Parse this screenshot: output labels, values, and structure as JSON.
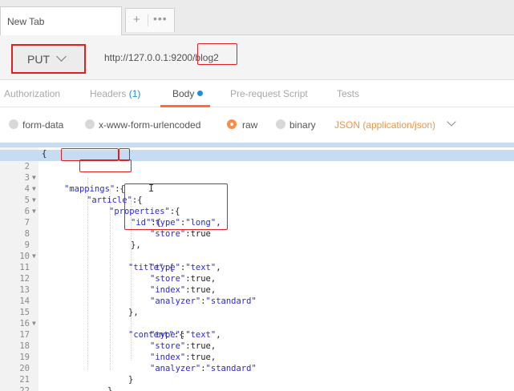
{
  "tab": {
    "title": "New Tab",
    "plus": "+",
    "more": "•••"
  },
  "request": {
    "method": "PUT",
    "url_base": "http://127.0.0.1:9200",
    "url_path": "/blog2"
  },
  "subtabs": [
    {
      "label": "Authorization"
    },
    {
      "label": "Headers",
      "count": "(1)"
    },
    {
      "label": "Body"
    },
    {
      "label": "Pre-request Script"
    },
    {
      "label": "Tests"
    }
  ],
  "body_options": {
    "form_data": "form-data",
    "urlencoded": "x-www-form-urlencoded",
    "raw": "raw",
    "binary": "binary",
    "content_type": "JSON (application/json)",
    "selected": "raw"
  },
  "editor": {
    "lines": [
      {
        "n": "2",
        "fold": true
      },
      {
        "n": "3",
        "fold": true
      },
      {
        "n": "4",
        "fold": true
      },
      {
        "n": "5",
        "fold": true
      },
      {
        "n": "6"
      },
      {
        "n": "7"
      },
      {
        "n": "8"
      },
      {
        "n": "9",
        "fold": true
      },
      {
        "n": "10"
      },
      {
        "n": "11"
      },
      {
        "n": "12"
      },
      {
        "n": "13"
      },
      {
        "n": "14"
      },
      {
        "n": "15",
        "fold": true
      },
      {
        "n": "16"
      },
      {
        "n": "17"
      },
      {
        "n": "18"
      },
      {
        "n": "19"
      },
      {
        "n": "20"
      },
      {
        "n": "21"
      },
      {
        "n": "22"
      }
    ],
    "text": {
      "l1": "{",
      "mappings_key": "\"mappings\"",
      "mappings_rest": ":{",
      "article_key": "\"article\"",
      "article_rest": ":{",
      "properties": "\"properties\"",
      "open": ":{",
      "id_key": "\"id\"",
      "type": "\"type\"",
      "store": "\"store\"",
      "index": "\"index\"",
      "analyzer": "\"analyzer\"",
      "long": "\"long\"",
      "text": "\"text\"",
      "standard": "\"standard\"",
      "true": "true",
      "title_key": "\"title\"",
      "content_key": "\"content\""
    }
  }
}
